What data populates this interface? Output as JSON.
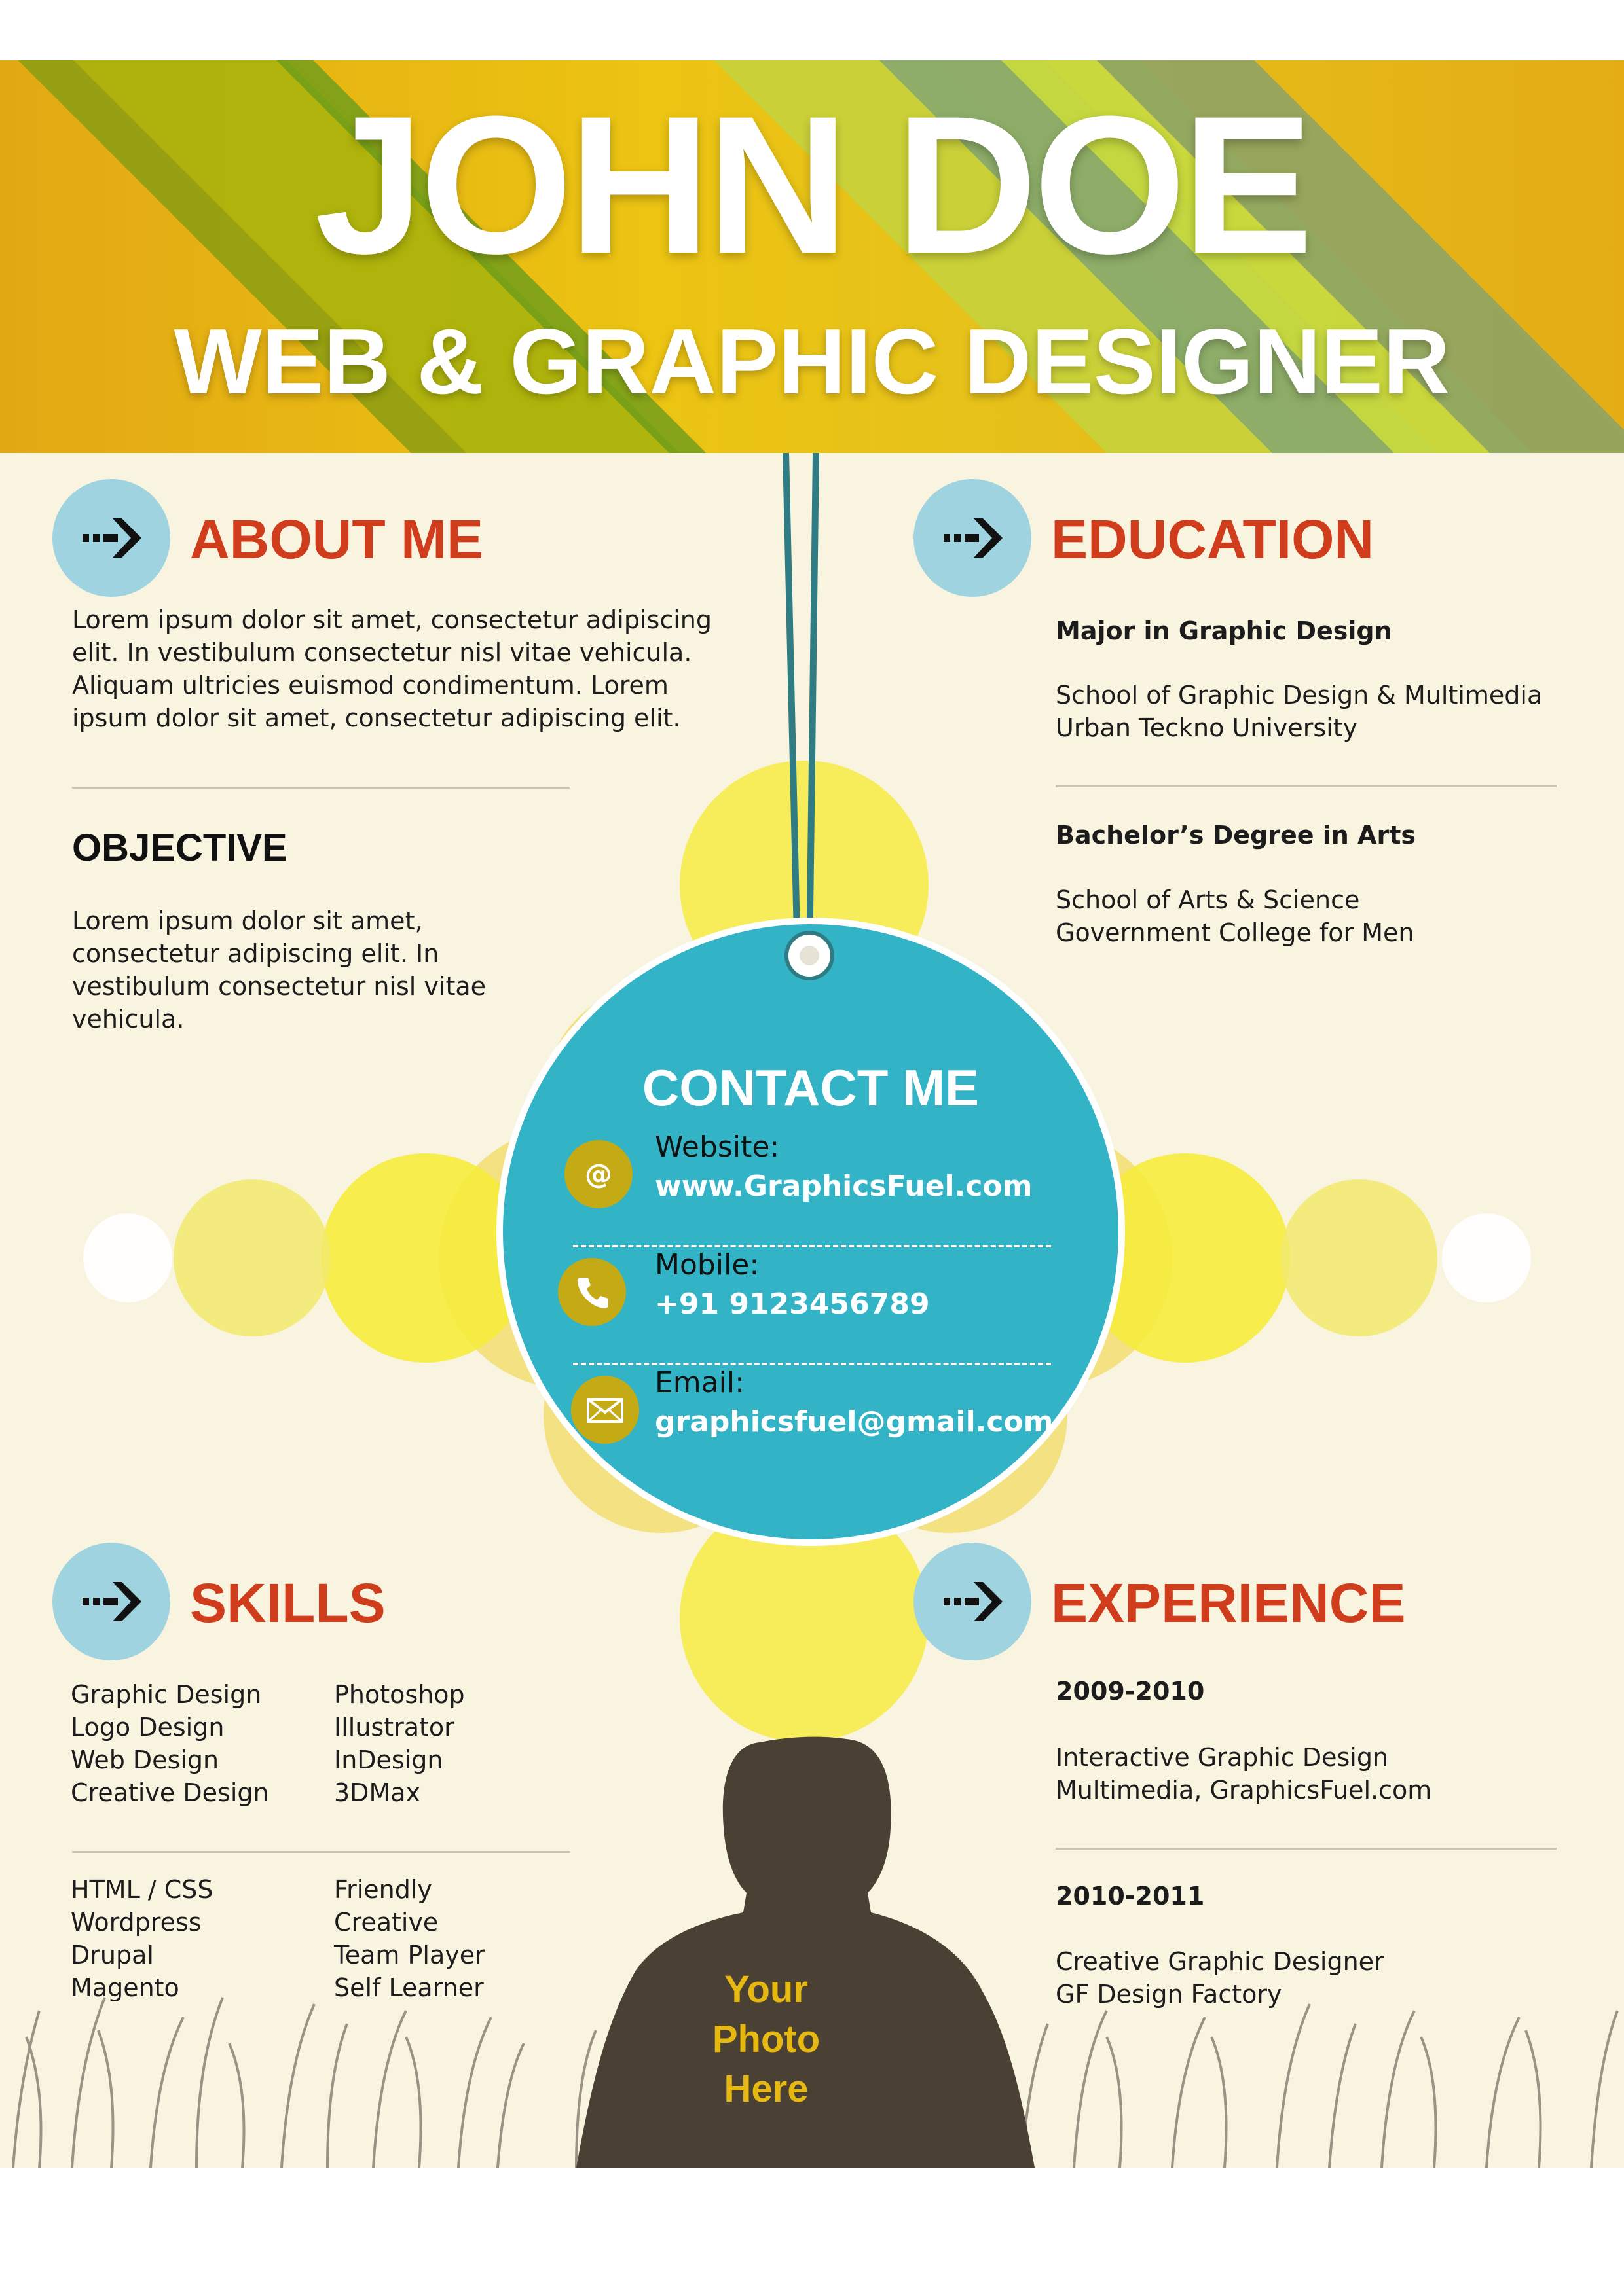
{
  "header": {
    "name": "JOHN DOE",
    "job_title": "WEB & GRAPHIC DESIGNER"
  },
  "about": {
    "title": "ABOUT  ME",
    "lines": [
      "Lorem ipsum dolor sit amet, consectetur adipiscing",
      "elit. In vestibulum consectetur nisl vitae vehicula.",
      "Aliquam ultricies euismod condimentum. Lorem",
      "ipsum dolor sit amet, consectetur adipiscing elit."
    ]
  },
  "objective": {
    "title": "OBJECTIVE",
    "lines": [
      "Lorem ipsum dolor sit amet,",
      "consectetur adipiscing elit. In",
      "vestibulum consectetur nisl vitae",
      "vehicula."
    ]
  },
  "education": {
    "title": "EDUCATION",
    "entries": [
      {
        "heading": "Major in Graphic Design",
        "line1": "School of Graphic Design & Multimedia",
        "line2": "Urban Teckno University"
      },
      {
        "heading": "Bachelor’s Degree in Arts",
        "line1": "School of Arts & Science",
        "line2": "Government College for Men"
      }
    ]
  },
  "contact": {
    "title": "CONTACT ME",
    "items": [
      {
        "label": "Website:",
        "value": "www.GraphicsFuel.com",
        "icon": "at-icon"
      },
      {
        "label": "Mobile:",
        "value": "+91 9123456789",
        "icon": "phone-icon"
      },
      {
        "label": "Email:",
        "value": "graphicsfuel@gmail.com",
        "icon": "envelope-icon"
      }
    ]
  },
  "skills": {
    "title": "SKILLS",
    "col1": [
      "Graphic Design",
      "Logo Design",
      "Web Design",
      "Creative Design"
    ],
    "col2": [
      "Photoshop",
      "Illustrator",
      "InDesign",
      "3DMax"
    ],
    "col3": [
      "HTML / CSS",
      "Wordpress",
      "Drupal",
      "Magento"
    ],
    "col4": [
      "Friendly",
      "Creative",
      "Team Player",
      "Self Learner"
    ]
  },
  "experience": {
    "title": "EXPERIENCE",
    "entries": [
      {
        "heading": "2009-2010",
        "line1": "Interactive Graphic Design",
        "line2": "Multimedia, GraphicsFuel.com"
      },
      {
        "heading": "2010-2011",
        "line1": "Creative Graphic Designer",
        "line2": "GF Design Factory"
      }
    ]
  },
  "photo": {
    "line1": "Your",
    "line2": "Photo",
    "line3": "Here"
  },
  "colors": {
    "banner_yellow": "#e8bf14",
    "heading_red": "#d03d1c",
    "icon_blue": "#9fd3df",
    "contact_teal": "#33b3c6",
    "contact_icon": "#c4aa14",
    "silhouette": "#4a4034",
    "background": "#f8f4df"
  }
}
